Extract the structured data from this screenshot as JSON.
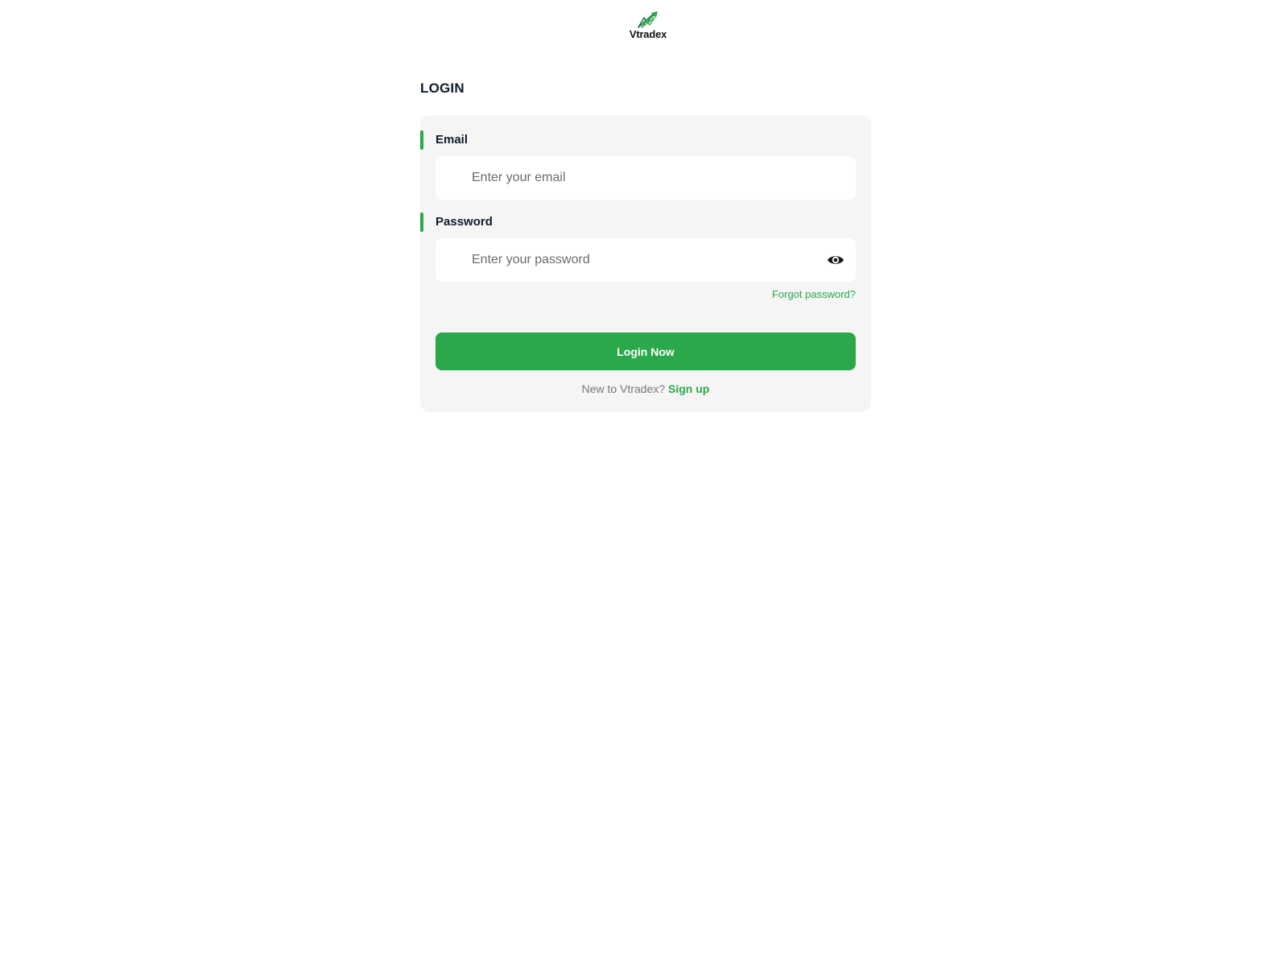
{
  "brand": {
    "name": "Vtradex",
    "logo_icon": "rising-chart-arrow-icon",
    "accent_color": "#2aa84a"
  },
  "page": {
    "title": "LOGIN"
  },
  "form": {
    "email": {
      "label": "Email",
      "placeholder": "Enter your email",
      "value": ""
    },
    "password": {
      "label": "Password",
      "placeholder": "Enter your password",
      "value": "",
      "toggle_icon": "eye-icon"
    },
    "forgot_password_label": "Forgot password?",
    "submit_label": "Login Now",
    "signup_prompt": "New to Vtradex?",
    "signup_label": "Sign up"
  }
}
